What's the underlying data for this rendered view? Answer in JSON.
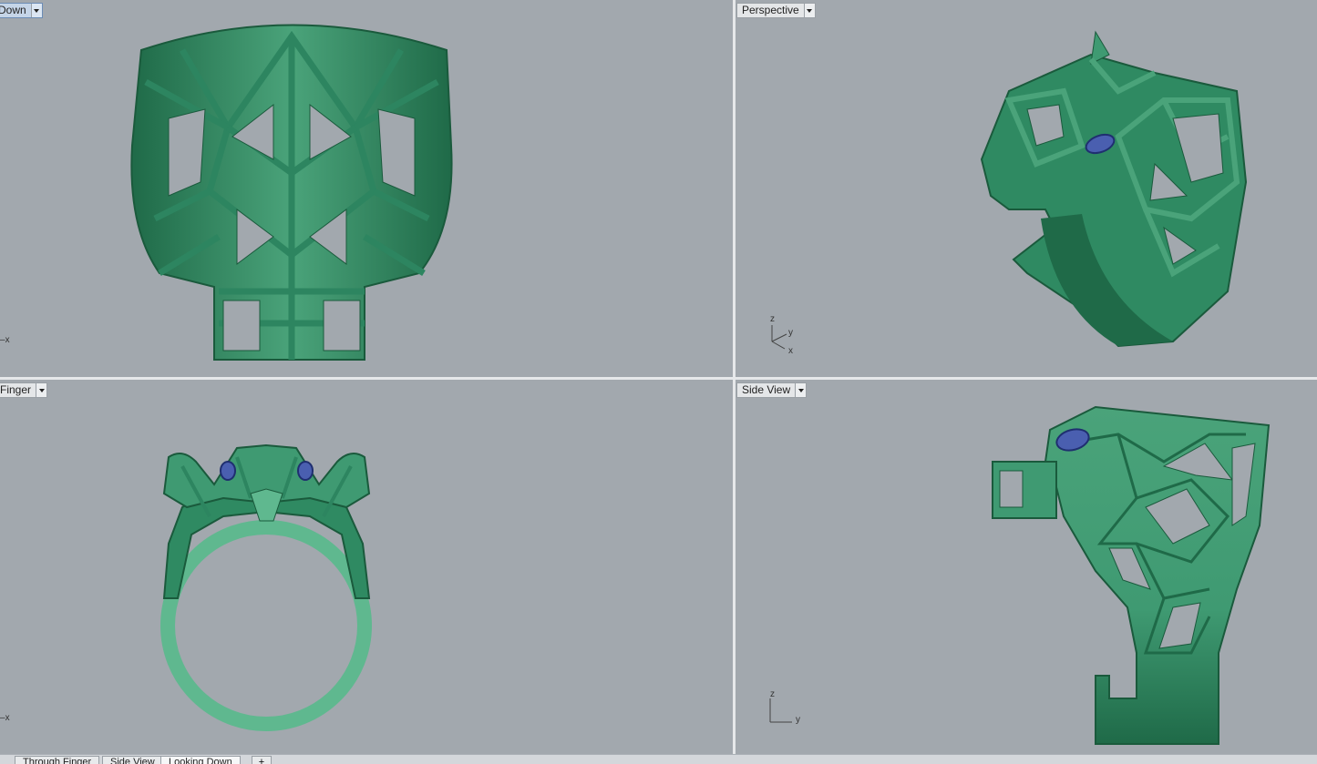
{
  "viewports": {
    "top_left": {
      "label": "Down",
      "active": true,
      "axis_x": "x"
    },
    "top_right": {
      "label": "Perspective",
      "axis_x": "x",
      "axis_y": "y",
      "axis_z": "z"
    },
    "bottom_left": {
      "label": "Finger",
      "axis_x": "x"
    },
    "bottom_right": {
      "label": "Side View",
      "axis_y": "y",
      "axis_z": "z"
    }
  },
  "tabs": [
    {
      "label": "Through Finger"
    },
    {
      "label": "Side View"
    },
    {
      "label": "Looking Down",
      "active": true
    }
  ],
  "tab_add_label": "+",
  "colors": {
    "viewport_bg": "#a2a8ae",
    "model_green": "#3f9a72",
    "model_dark": "#1f6a48",
    "gem_blue": "#4a5fb0"
  },
  "icons": [
    "dropdown-arrow-icon",
    "axis-triad-icon"
  ]
}
